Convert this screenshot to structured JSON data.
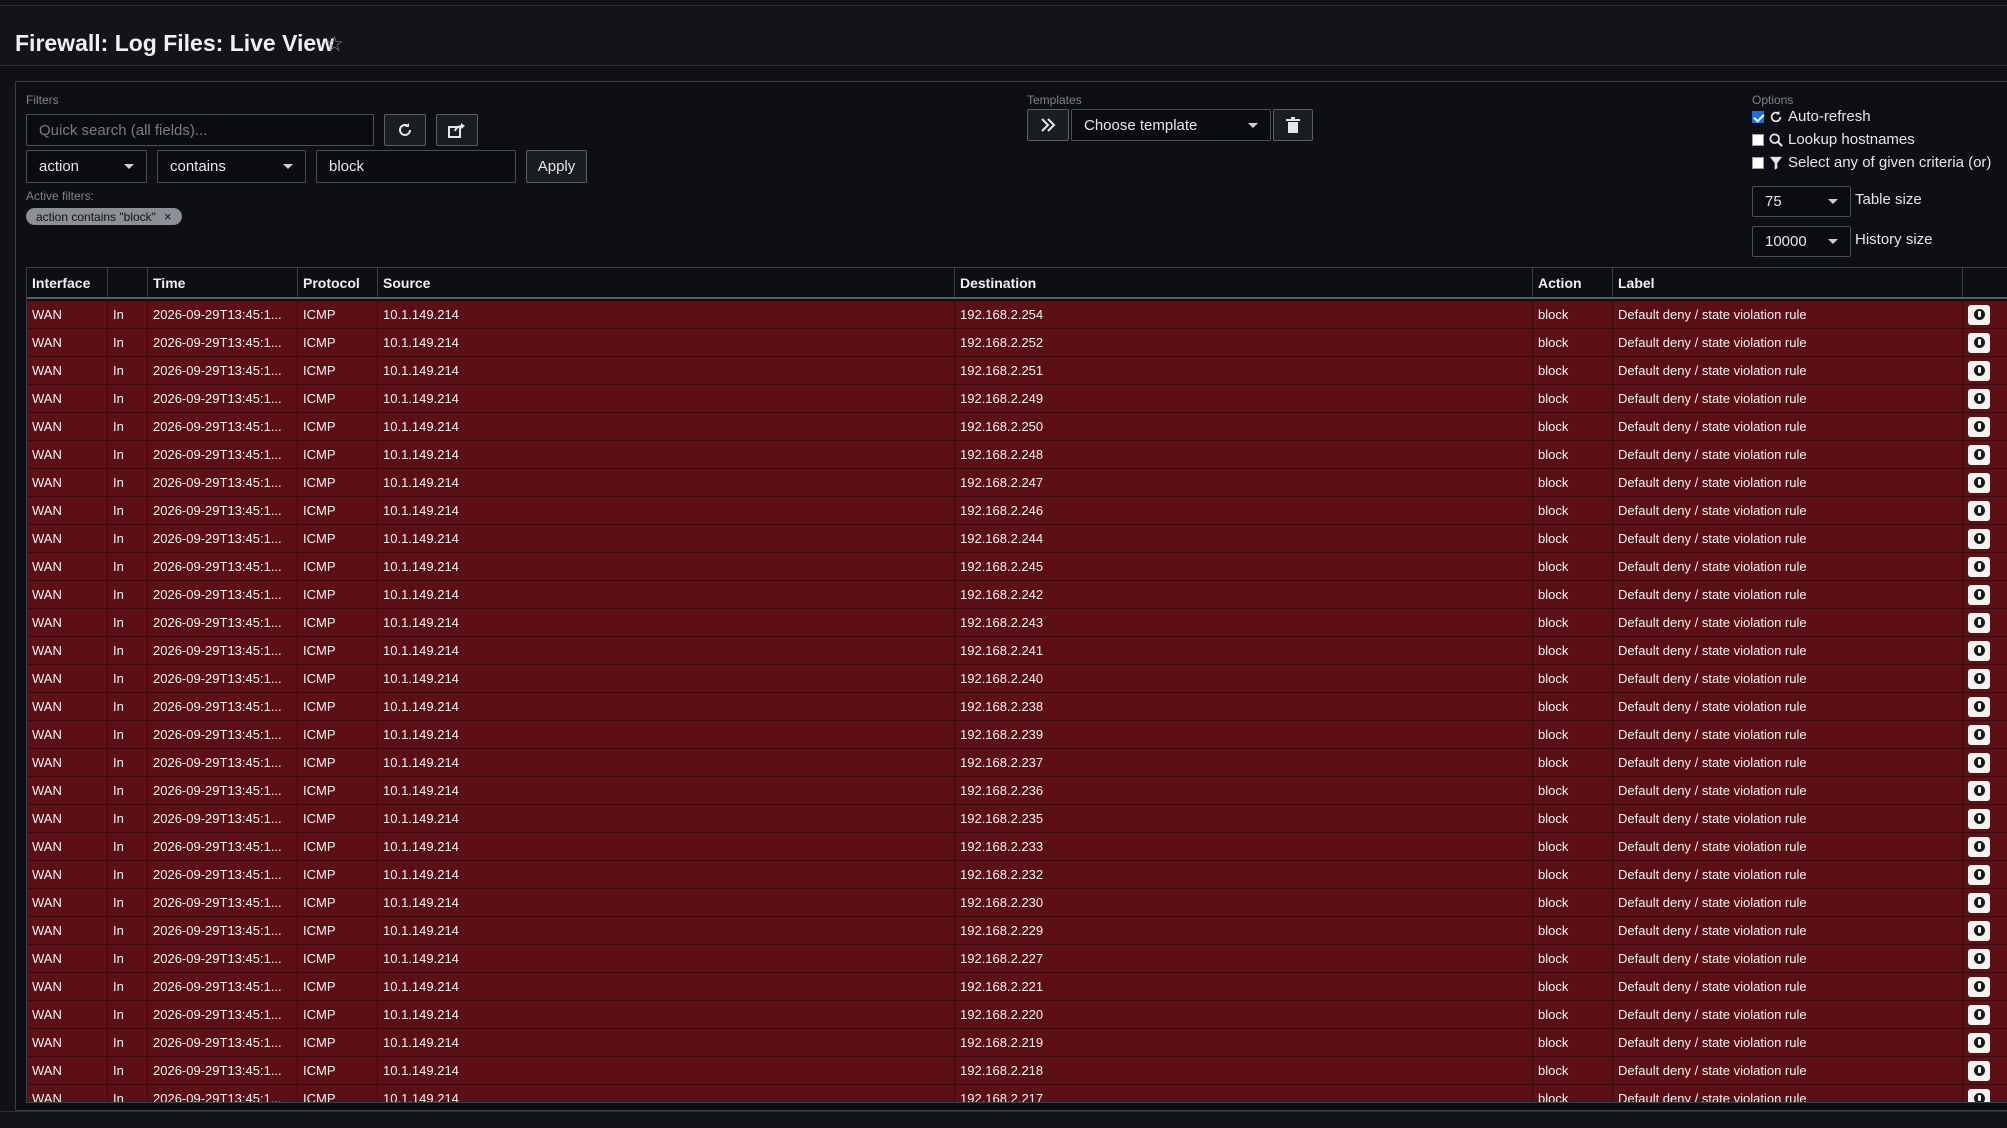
{
  "page": {
    "title": "Firewall: Log Files: Live View",
    "star_icon": "star-icon"
  },
  "filters": {
    "section_label": "Filters",
    "search_placeholder": "Quick search (all fields)...",
    "refresh_icon": "refresh-icon",
    "export_icon": "share-export-icon",
    "field_select": "action",
    "operator_select": "contains",
    "value_input": "block",
    "apply_label": "Apply",
    "active_label": "Active filters:",
    "active_chip": "action contains \"block\"",
    "chip_remove": "×"
  },
  "templates": {
    "section_label": "Templates",
    "forward_icon": "double-chevron-right-icon",
    "choose_label": "Choose template",
    "delete_icon": "trash-icon"
  },
  "options": {
    "section_label": "Options",
    "auto_refresh": {
      "label": "Auto-refresh",
      "checked": true,
      "icon": "refresh-icon"
    },
    "lookup_hostnames": {
      "label": "Lookup hostnames",
      "checked": false,
      "icon": "search-icon"
    },
    "select_any": {
      "label": "Select any of given criteria (or)",
      "checked": false,
      "icon": "filter-icon"
    },
    "table_size": {
      "value": "75",
      "label": "Table size"
    },
    "history_size": {
      "value": "10000",
      "label": "History size"
    }
  },
  "table": {
    "columns": [
      "Interface",
      "",
      "Time",
      "Protocol",
      "Source",
      "Destination",
      "Action",
      "Label",
      ""
    ],
    "row_template": {
      "interface": "WAN",
      "dir": "In",
      "time": "2026-09-29T13:45:1...",
      "protocol": "ICMP",
      "source": "10.1.149.214",
      "action": "block",
      "label": "Default deny / state violation rule"
    },
    "destinations": [
      "192.168.2.254",
      "192.168.2.252",
      "192.168.2.251",
      "192.168.2.249",
      "192.168.2.250",
      "192.168.2.248",
      "192.168.2.247",
      "192.168.2.246",
      "192.168.2.244",
      "192.168.2.245",
      "192.168.2.242",
      "192.168.2.243",
      "192.168.2.241",
      "192.168.2.240",
      "192.168.2.238",
      "192.168.2.239",
      "192.168.2.237",
      "192.168.2.236",
      "192.168.2.235",
      "192.168.2.233",
      "192.168.2.232",
      "192.168.2.230",
      "192.168.2.229",
      "192.168.2.227",
      "192.168.2.221",
      "192.168.2.220",
      "192.168.2.219",
      "192.168.2.218",
      "192.168.2.217"
    ],
    "row_info_icon": "info-icon"
  }
}
